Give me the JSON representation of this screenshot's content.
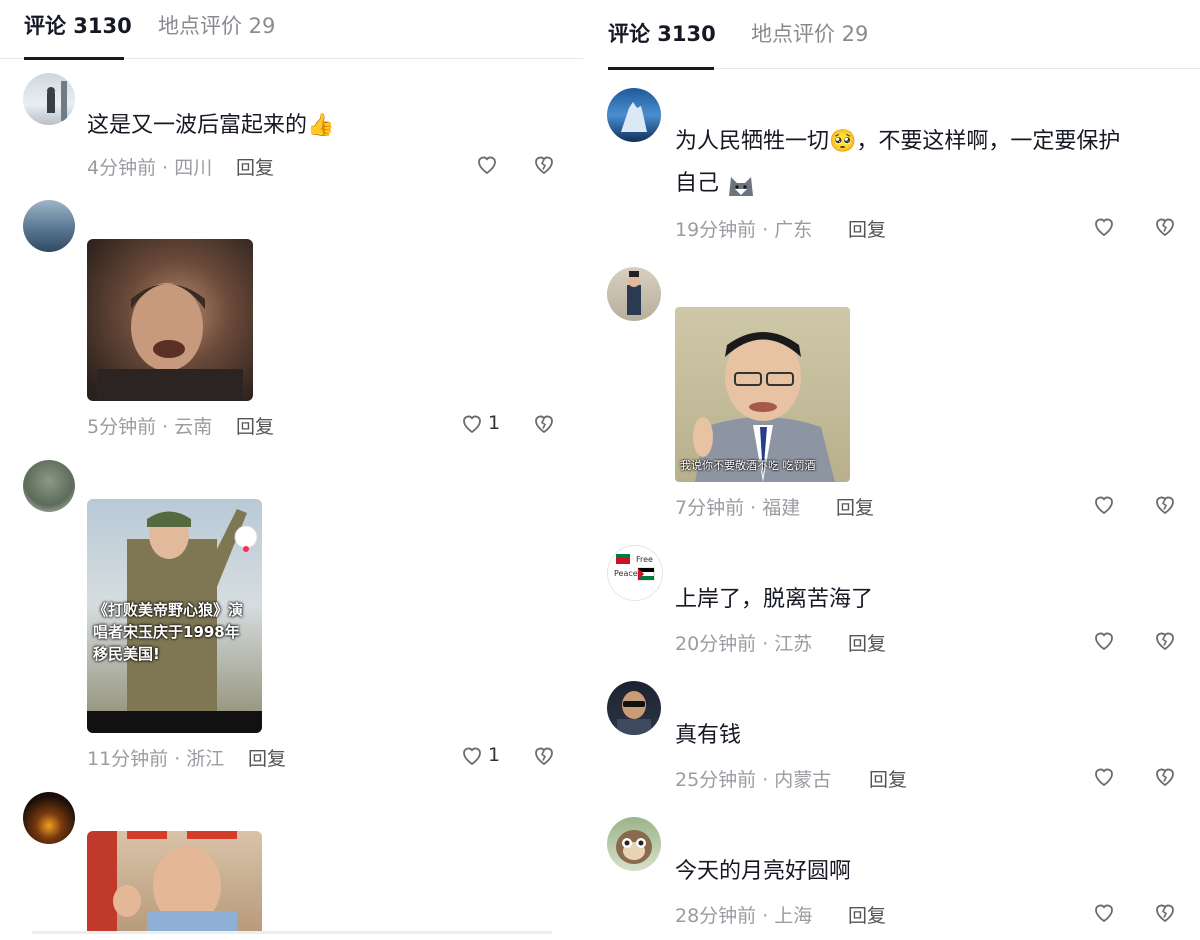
{
  "tabs": {
    "comments": "评论 3130",
    "place_reviews": "地点评价 29"
  },
  "left_comments": [
    {
      "text": "这是又一波后富起来的",
      "emoji": "👍",
      "meta": "4分钟前 · 四川",
      "reply": "回复",
      "likes": ""
    },
    {
      "image_caption": "",
      "meta": "5分钟前 · 云南",
      "reply": "回复",
      "likes": "1"
    },
    {
      "image_caption": "《打败美帝野心狼》演唱者宋玉庆于1998年移民美国!",
      "meta": "11分钟前 · 浙江",
      "reply": "回复",
      "likes": "1"
    },
    {
      "image_caption": "",
      "meta": "",
      "reply": "",
      "likes": ""
    }
  ],
  "right_comments": [
    {
      "text": "为人民牺牲一切🥺，不要这样啊，一定要保护自己",
      "line1": "为人民牺牲一切🥺，不要这样啊，一定要保护",
      "line2": "自己",
      "meta": "19分钟前 · 广东",
      "reply": "回复"
    },
    {
      "image_caption": "我说你不要敬酒不吃 吃罚酒",
      "meta": "7分钟前 · 福建",
      "reply": "回复"
    },
    {
      "text": "上岸了，脱离苦海了",
      "meta": "20分钟前 · 江苏",
      "reply": "回复",
      "avatar_text": [
        "Free",
        "Peace"
      ]
    },
    {
      "text": "真有钱",
      "meta": "25分钟前 · 内蒙古",
      "reply": "回复"
    },
    {
      "text": "今天的月亮好圆啊",
      "meta": "28分钟前 · 上海",
      "reply": "回复"
    }
  ],
  "colors": {
    "text": "#161823",
    "muted": "#9b9ca1",
    "heart": "#6b6c70"
  }
}
